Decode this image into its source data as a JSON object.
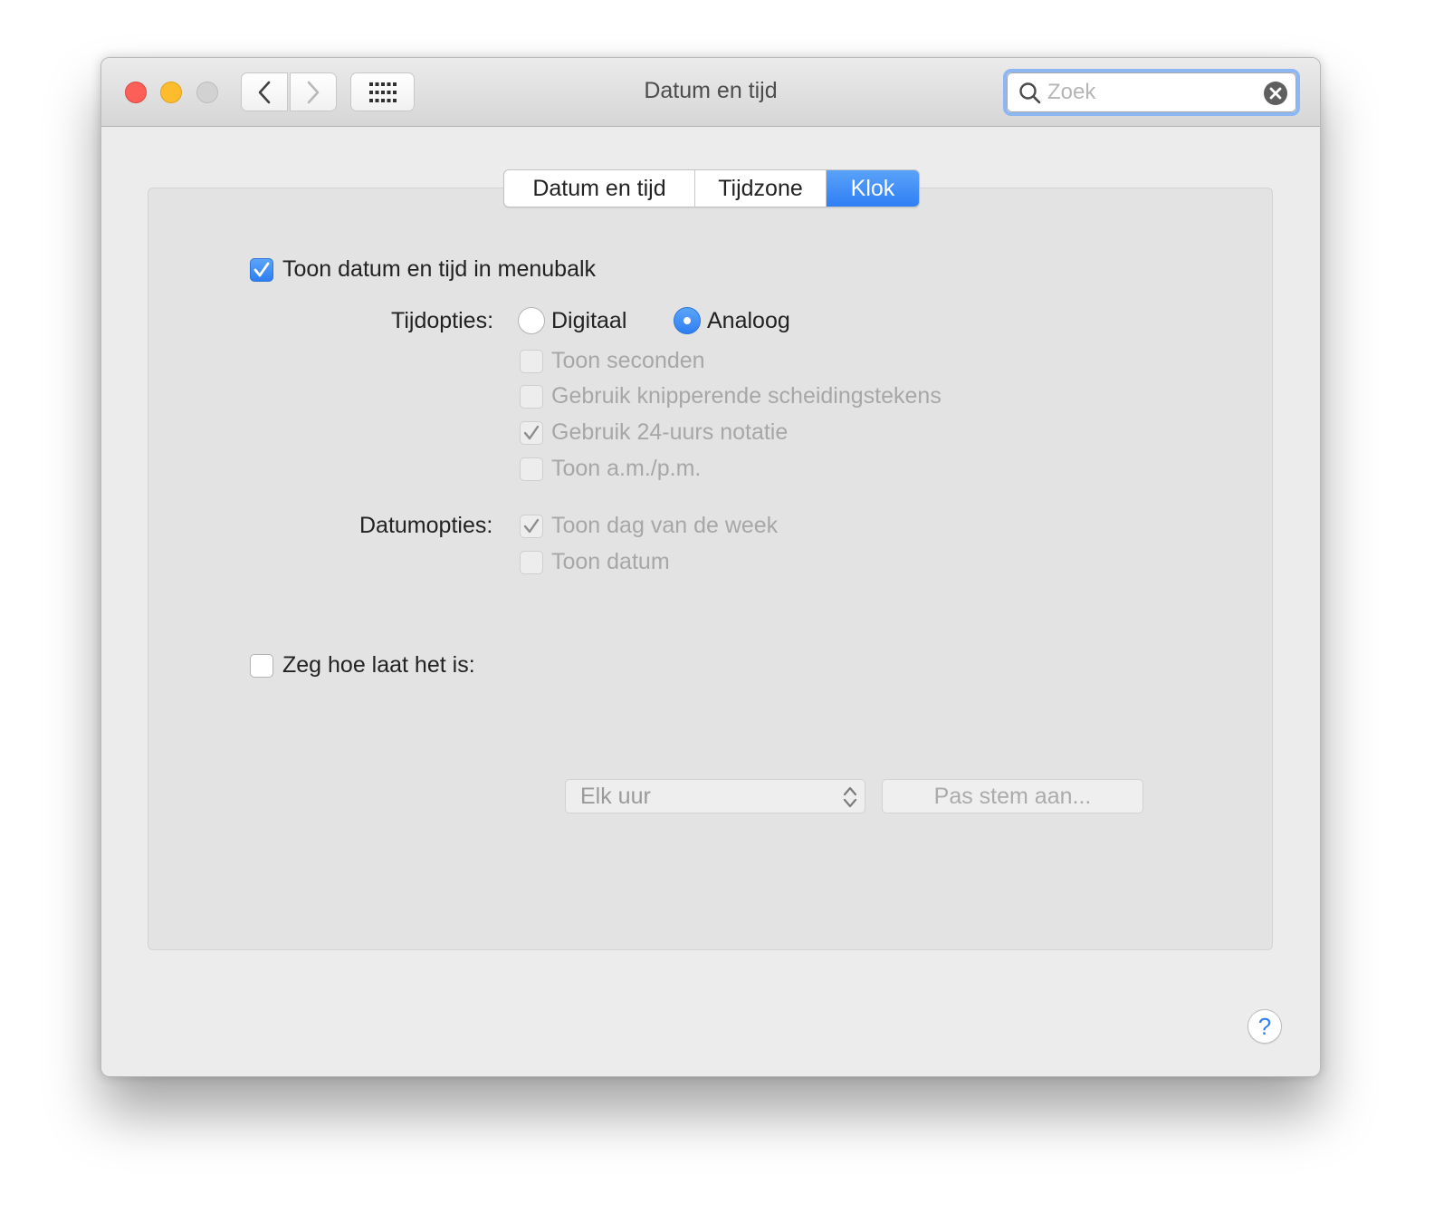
{
  "window": {
    "title": "Datum en tijd"
  },
  "toolbar": {
    "back_icon": "chevron-left-icon",
    "forward_icon": "chevron-right-icon",
    "grid_icon": "grid-icon"
  },
  "search": {
    "placeholder": "Zoek",
    "value": ""
  },
  "tabs": [
    {
      "label": "Datum en tijd",
      "selected": false
    },
    {
      "label": "Tijdzone",
      "selected": false
    },
    {
      "label": "Klok",
      "selected": true
    }
  ],
  "clock": {
    "show_in_menubar": {
      "label": "Toon datum en tijd in menubalk",
      "checked": true
    },
    "time_options": {
      "label": "Tijdopties:",
      "radios": [
        {
          "label": "Digitaal",
          "selected": false
        },
        {
          "label": "Analoog",
          "selected": true
        }
      ],
      "checkboxes": [
        {
          "label": "Toon seconden",
          "checked": false,
          "enabled": false
        },
        {
          "label": "Gebruik knipperende scheidingstekens",
          "checked": false,
          "enabled": false
        },
        {
          "label": "Gebruik 24-uurs notatie",
          "checked": true,
          "enabled": false
        },
        {
          "label": "Toon a.m./p.m.",
          "checked": false,
          "enabled": false
        }
      ]
    },
    "date_options": {
      "label": "Datumopties:",
      "checkboxes": [
        {
          "label": "Toon dag van de week",
          "checked": true,
          "enabled": false
        },
        {
          "label": "Toon datum",
          "checked": false,
          "enabled": false
        }
      ]
    },
    "announce": {
      "label": "Zeg hoe laat het is:",
      "checked": false,
      "interval": "Elk uur",
      "voice_button": "Pas stem aan..."
    }
  },
  "help_label": "?",
  "colors": {
    "accent": "#2f7ff5",
    "close": "#fc5f57",
    "minimize": "#fdbc2e",
    "zoom_disabled": "#d2d2d2"
  }
}
